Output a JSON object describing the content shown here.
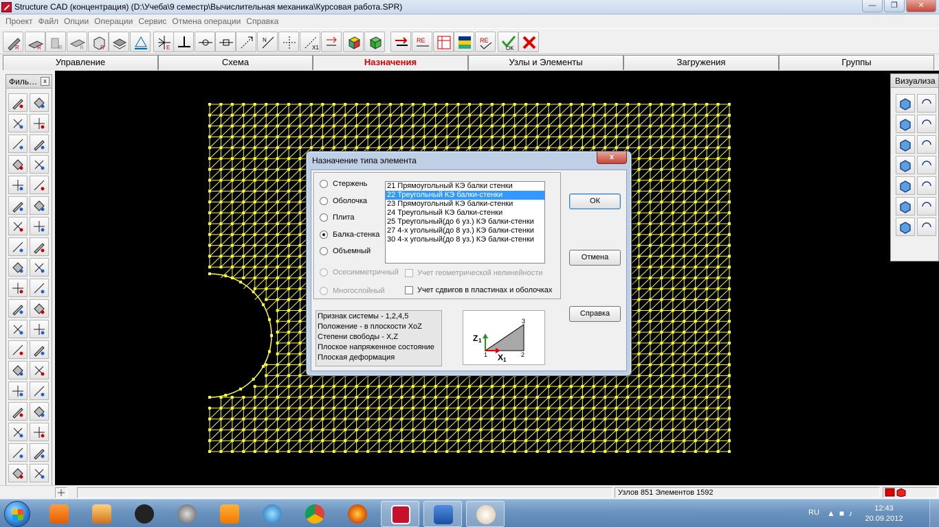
{
  "window": {
    "title": "Structure CAD (концентрация) (D:\\Учеба\\9 семестр\\Вычислительная механика\\Курсовая работа.SPR)",
    "minimize_icon": "minimize-icon",
    "maximize_icon": "restore-icon",
    "close_icon": "close-icon"
  },
  "menu": {
    "items": [
      "Проект",
      "Файл",
      "Опции",
      "Операции",
      "Сервис",
      "Отмена операции",
      "Справка"
    ]
  },
  "tabs": [
    {
      "label": "Управление"
    },
    {
      "label": "Схема"
    },
    {
      "label": "Назначения"
    },
    {
      "label": "Узлы и Элементы"
    },
    {
      "label": "Загружения"
    },
    {
      "label": "Группы"
    }
  ],
  "left_palette": {
    "title": "Филь…",
    "close_glyph": "x"
  },
  "right_palette": {
    "title": "Визуализа"
  },
  "colors": {
    "mesh": "#ffff33",
    "accent_tab": "#d40000",
    "selection": "#3399ff"
  },
  "dialog": {
    "title": "Назначение типа элемента",
    "close_glyph": "x",
    "radios": [
      {
        "label": "Стержень",
        "checked": false,
        "disabled": false
      },
      {
        "label": "Оболочка",
        "checked": false,
        "disabled": false
      },
      {
        "label": "Плита",
        "checked": false,
        "disabled": false
      },
      {
        "label": "Балка-стенка",
        "checked": true,
        "disabled": false
      },
      {
        "label": "Объемный",
        "checked": false,
        "disabled": false
      },
      {
        "label": "Осесимметричный",
        "checked": false,
        "disabled": true
      },
      {
        "label": "Многослойный",
        "checked": false,
        "disabled": true
      }
    ],
    "checkboxes": [
      {
        "label": "Учет геометрической нелинейности",
        "checked": false,
        "disabled": true
      },
      {
        "label": "Учет сдвигов в пластинах и оболочках",
        "checked": false,
        "disabled": false
      }
    ],
    "list_items": [
      "21 Прямоугольный КЭ балки стенки",
      "22 Треугольный КЭ балки-стенки",
      "23 Прямоугольный КЭ балки-стенки",
      "24 Треугольный КЭ балки-стенки",
      "25 Треугольный(до 6 уз.) КЭ балки-стенки",
      "27 4-х угольный(до 8 уз.) КЭ балки-стенки",
      "30 4-х угольный(до 8 уз.) КЭ балки-стенки"
    ],
    "selected_index": 1,
    "info_lines": [
      "Признак системы - 1,2,4,5",
      "Положение - в плоскости XoZ",
      "Степени свободы - X,Z",
      "Плоское напряженное состояние",
      "Плоская деформация"
    ],
    "diagram": {
      "node1": "1",
      "node2": "2",
      "node3": "3",
      "axis_z": "Z",
      "axis_x": "X",
      "axis_sub": "1"
    },
    "buttons": {
      "ok": "ОК",
      "cancel": "Отмена",
      "help": "Справка"
    }
  },
  "status": {
    "text": "Узлов 851 Элементов 1592"
  },
  "taskbar": {
    "lang": "RU",
    "time": "12:43",
    "date": "20.09.2012"
  }
}
